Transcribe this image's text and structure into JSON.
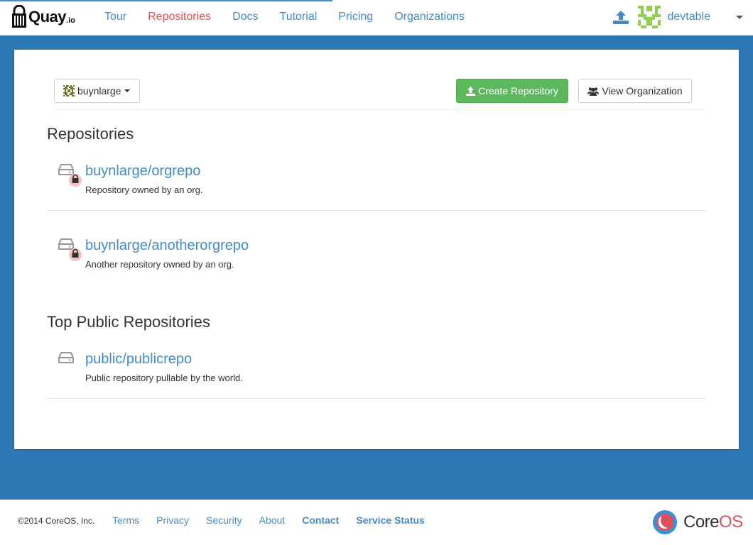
{
  "navbar": {
    "brand": "Quay",
    "brand_tld": ".io",
    "links": [
      "Tour",
      "Repositories",
      "Docs",
      "Tutorial",
      "Pricing",
      "Organizations"
    ],
    "active": "Repositories",
    "user": "devtable"
  },
  "toolbar": {
    "org_name": "buynlarge",
    "create_label": "Create Repository",
    "view_label": "View Organization"
  },
  "repositories": {
    "title": "Repositories",
    "items": [
      {
        "name": "buynlarge/orgrepo",
        "description": "Repository owned by an org.",
        "private": true
      },
      {
        "name": "buynlarge/anotherorgrepo",
        "description": "Another repository owned by an org.",
        "private": true
      }
    ]
  },
  "public_repositories": {
    "title": "Top Public Repositories",
    "items": [
      {
        "name": "public/publicrepo",
        "description": "Public repository pullable by the world.",
        "private": false
      }
    ]
  },
  "footer": {
    "copyright": "©2014 CoreOS, Inc.",
    "links": [
      "Terms",
      "Privacy",
      "Security",
      "About"
    ],
    "bold_links": [
      "Contact",
      "Service Status"
    ],
    "coreos_core": "Core",
    "coreos_os": "OS"
  },
  "colors": {
    "primary": "#428bca",
    "active_nav": "#e14f5a",
    "background": "#2b78b2",
    "success": "#5cb85c"
  }
}
